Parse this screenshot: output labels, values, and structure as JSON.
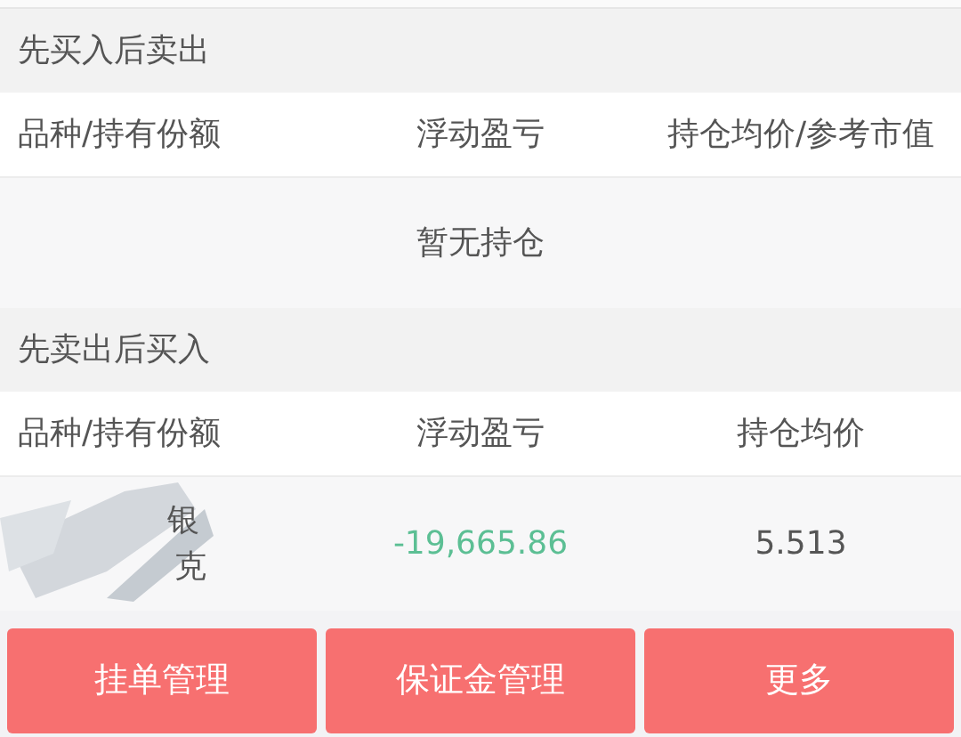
{
  "sections": [
    {
      "title": "先买入后卖出",
      "columns": [
        "品种/持有份额",
        "浮动盈亏",
        "持仓均价/参考市值"
      ],
      "empty_text": "暂无持仓"
    },
    {
      "title": "先卖出后买入",
      "columns": [
        "品种/持有份额",
        "浮动盈亏",
        "持仓均价"
      ],
      "rows": [
        {
          "name": "银",
          "quantity": "克",
          "profit": "-19,665.86",
          "price": "5.513"
        }
      ]
    }
  ],
  "buttons": [
    "挂单管理",
    "保证金管理",
    "更多"
  ]
}
